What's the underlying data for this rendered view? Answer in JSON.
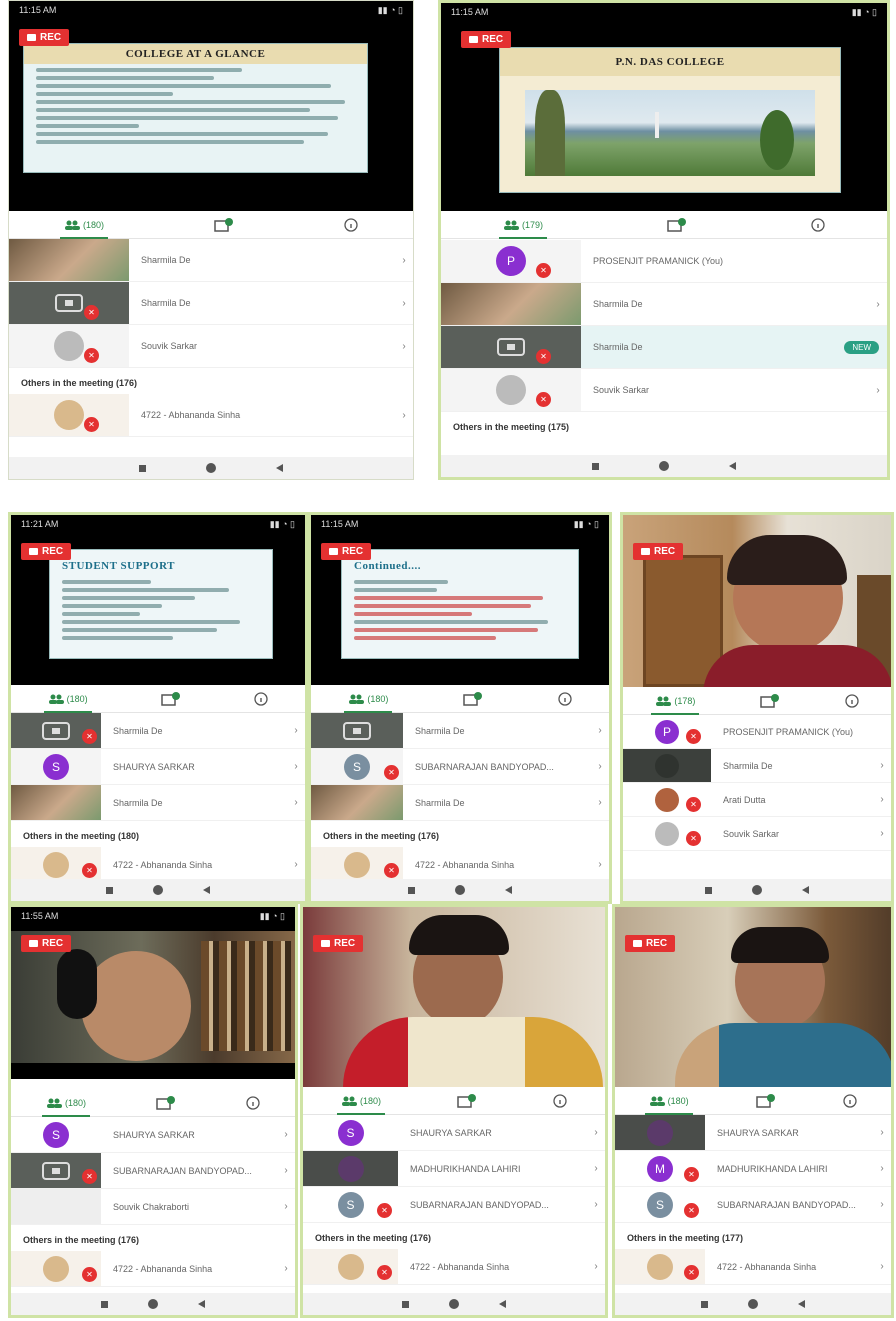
{
  "rec_label": "REC",
  "tabs": {
    "participants_icon": "people-icon",
    "chat_icon": "chat-icon",
    "info_icon": "info-icon"
  },
  "screens": [
    {
      "status_time": "11:15 AM",
      "slide_title": "COLLEGE AT A GLANCE",
      "participant_count": "(180)",
      "rows": [
        {
          "name": "Sharmila De",
          "thumb": "camera"
        },
        {
          "name": "Sharmila De",
          "thumb": "screen"
        },
        {
          "name": "Souvik Sarkar",
          "thumb": "avatar-face"
        }
      ],
      "others": "Others in the meeting (176)",
      "others_first": "4722 - Abhananda Sinha"
    },
    {
      "status_time": "11:15 AM",
      "slide_title": "P.N. DAS COLLEGE",
      "participant_count": "(179)",
      "rows": [
        {
          "name": "PROSENJIT PRAMANICK (You)",
          "thumb": "letter",
          "letter": "P",
          "color": "#8a2fd0"
        },
        {
          "name": "Sharmila De",
          "thumb": "camera"
        },
        {
          "name": "Sharmila De",
          "thumb": "screen",
          "tag": "NEW"
        },
        {
          "name": "Souvik Sarkar",
          "thumb": "avatar-face"
        }
      ],
      "others": "Others in the meeting (175)"
    },
    {
      "status_time": "11:21 AM",
      "slide_title": "STUDENT SUPPORT",
      "participant_count": "(180)",
      "rows": [
        {
          "name": "Sharmila De",
          "thumb": "screen"
        },
        {
          "name": "SHAURYA SARKAR",
          "thumb": "letter",
          "letter": "S",
          "color": "#8a2fd0"
        },
        {
          "name": "Sharmila De",
          "thumb": "camera"
        }
      ],
      "others": "Others in the meeting (180)",
      "others_first": "4722 - Abhananda Sinha"
    },
    {
      "status_time": "11:15 AM",
      "slide_title": "Continued....",
      "participant_count": "(180)",
      "rows": [
        {
          "name": "Sharmila De",
          "thumb": "screen"
        },
        {
          "name": "SUBARNARAJAN BANDYOPAD...",
          "thumb": "letter",
          "letter": "S",
          "color": "#7a8fa0"
        },
        {
          "name": "Sharmila De",
          "thumb": "camera"
        }
      ],
      "others": "Others in the meeting (176)",
      "others_first": "4722 - Abhananda Sinha"
    },
    {
      "participant_count": "(178)",
      "rows": [
        {
          "name": "PROSENJIT PRAMANICK (You)",
          "thumb": "letter",
          "letter": "P",
          "color": "#8a2fd0"
        },
        {
          "name": "Sharmila De",
          "thumb": "dark"
        },
        {
          "name": "Arati Dutta",
          "thumb": "avatar-face"
        },
        {
          "name": "Souvik Sarkar",
          "thumb": "avatar-face"
        }
      ]
    },
    {
      "status_time": "11:55 AM",
      "participant_count": "(180)",
      "rows": [
        {
          "name": "SHAURYA SARKAR",
          "thumb": "letter",
          "letter": "S",
          "color": "#8a2fd0"
        },
        {
          "name": "SUBARNARAJAN BANDYOPAD...",
          "thumb": "screen"
        },
        {
          "name": "Souvik Chakraborti",
          "thumb": "light"
        }
      ],
      "others": "Others in the meeting (176)",
      "others_first": "4722 - Abhananda Sinha"
    },
    {
      "participant_count": "(180)",
      "rows": [
        {
          "name": "SHAURYA SARKAR",
          "thumb": "letter",
          "letter": "S",
          "color": "#8a2fd0"
        },
        {
          "name": "MADHURIKHANDA LAHIRI",
          "thumb": "dark"
        },
        {
          "name": "SUBARNARAJAN BANDYOPAD...",
          "thumb": "letter",
          "letter": "S",
          "color": "#7a8fa0"
        }
      ],
      "others": "Others in the meeting (176)",
      "others_first": "4722 - Abhananda Sinha"
    },
    {
      "participant_count": "(180)",
      "rows": [
        {
          "name": "SHAURYA SARKAR",
          "thumb": "dark"
        },
        {
          "name": "MADHURIKHANDA LAHIRI",
          "thumb": "letter",
          "letter": "M",
          "color": "#8a2fd0"
        },
        {
          "name": "SUBARNARAJAN BANDYOPAD...",
          "thumb": "letter",
          "letter": "S",
          "color": "#7a8fa0"
        }
      ],
      "others": "Others in the meeting (177)",
      "others_first": "4722 - Abhananda Sinha"
    }
  ]
}
